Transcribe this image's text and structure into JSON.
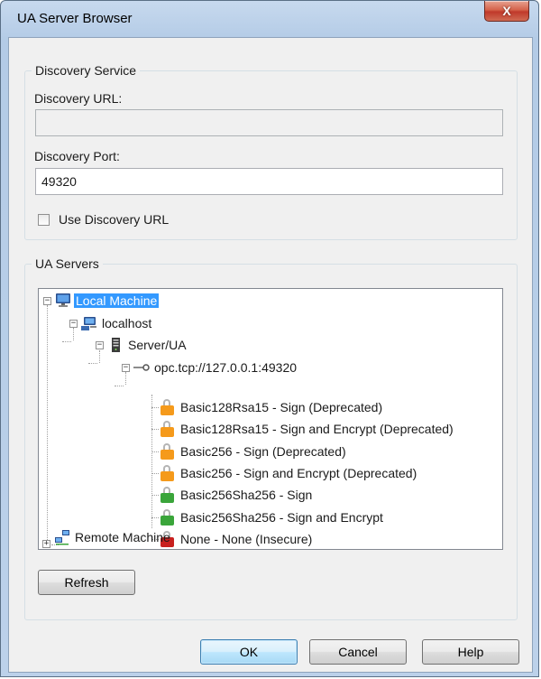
{
  "window": {
    "title": "UA Server Browser",
    "close_glyph": "X"
  },
  "discovery": {
    "group_title": "Discovery Service",
    "url_label": "Discovery URL:",
    "url_value": "",
    "port_label": "Discovery Port:",
    "port_value": "49320",
    "use_url_label": "Use Discovery URL",
    "use_url_checked": false
  },
  "servers": {
    "group_title": "UA Servers",
    "tree": {
      "local_machine": "Local Machine",
      "localhost": "localhost",
      "server": "Server/UA",
      "endpoint": "opc.tcp://127.0.0.1:49320",
      "policies": [
        {
          "label": "Basic128Rsa15 - Sign (Deprecated)",
          "lock_color": "#f59a1b"
        },
        {
          "label": "Basic128Rsa15 - Sign and Encrypt (Deprecated)",
          "lock_color": "#f59a1b"
        },
        {
          "label": "Basic256 - Sign (Deprecated)",
          "lock_color": "#f59a1b"
        },
        {
          "label": "Basic256 - Sign and Encrypt (Deprecated)",
          "lock_color": "#f59a1b"
        },
        {
          "label": "Basic256Sha256 - Sign",
          "lock_color": "#3aa53a"
        },
        {
          "label": "Basic256Sha256 - Sign and Encrypt",
          "lock_color": "#3aa53a"
        },
        {
          "label": "None - None (Insecure)",
          "lock_color": "#c8201e"
        }
      ],
      "remote_machine": "Remote Machine",
      "selected": "Local Machine"
    },
    "refresh_label": "Refresh"
  },
  "buttons": {
    "ok": "OK",
    "cancel": "Cancel",
    "help": "Help"
  }
}
